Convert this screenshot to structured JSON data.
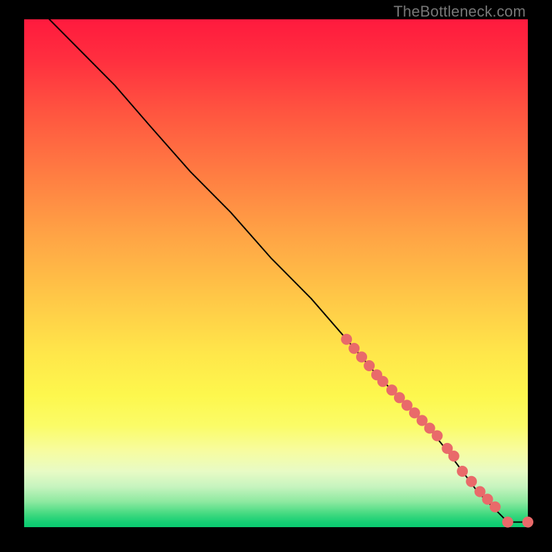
{
  "attribution": "TheBottleneck.com",
  "chart_data": {
    "type": "line",
    "title": "",
    "xlabel": "",
    "ylabel": "",
    "xlim": [
      0,
      100
    ],
    "ylim": [
      0,
      100
    ],
    "grid": false,
    "legend": false,
    "background_gradient": {
      "direction": "vertical",
      "stops": [
        {
          "pos": 0.0,
          "color": "#ff1a3e"
        },
        {
          "pos": 0.3,
          "color": "#ff7b42"
        },
        {
          "pos": 0.55,
          "color": "#ffc847"
        },
        {
          "pos": 0.74,
          "color": "#fdf74d"
        },
        {
          "pos": 0.89,
          "color": "#e8fbc5"
        },
        {
          "pos": 1.0,
          "color": "#0acc71"
        }
      ]
    },
    "series": [
      {
        "name": "curve",
        "style": "line",
        "color": "#000000",
        "x": [
          5,
          8,
          12,
          18,
          25,
          33,
          41,
          49,
          57,
          64,
          70,
          75,
          80,
          84,
          87,
          90,
          93,
          96,
          100
        ],
        "y": [
          100,
          97,
          93,
          87,
          79,
          70,
          62,
          53,
          45,
          37,
          30,
          25,
          20,
          15,
          11,
          7,
          4,
          1,
          1
        ]
      },
      {
        "name": "markers",
        "style": "scatter",
        "color": "#e96a6a",
        "radius": 8,
        "x": [
          64.0,
          65.5,
          67.0,
          68.5,
          70.0,
          71.2,
          73.0,
          74.5,
          76.0,
          77.5,
          79.0,
          80.5,
          82.0,
          84.0,
          85.3,
          87.0,
          88.8,
          90.5,
          92.0,
          93.5,
          96.0,
          100.0
        ],
        "y": [
          37.0,
          35.2,
          33.5,
          31.8,
          30.0,
          28.7,
          27.0,
          25.5,
          24.0,
          22.5,
          21.0,
          19.5,
          18.0,
          15.5,
          14.0,
          11.0,
          9.0,
          7.0,
          5.5,
          4.0,
          1.0,
          1.0
        ]
      }
    ]
  }
}
